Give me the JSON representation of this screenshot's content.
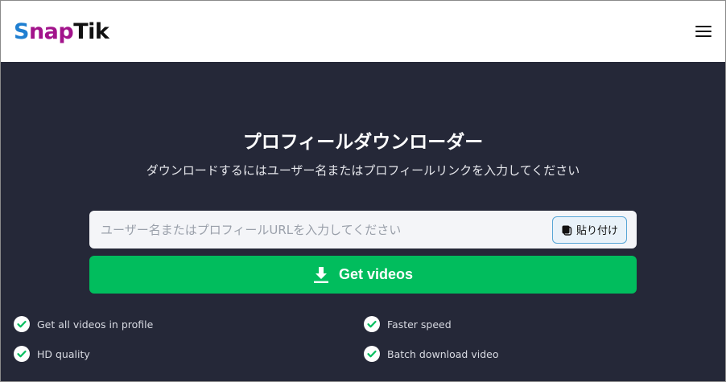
{
  "header": {
    "logo": {
      "part1": "Snap",
      "part2": "Tik"
    },
    "menu_icon": "hamburger-menu-icon"
  },
  "hero": {
    "title": "プロフィールダウンローダー",
    "subtitle": "ダウンロードするにはユーザー名またはプロフィールリンクを入力してください"
  },
  "search": {
    "placeholder": "ユーザー名またはプロフィールURLを入力してください",
    "value": "",
    "paste_label": "貼り付け",
    "paste_icon": "clipboard-icon"
  },
  "submit": {
    "label": "Get videos",
    "icon": "download-icon"
  },
  "features": [
    {
      "label": "Get all videos in profile"
    },
    {
      "label": "Faster speed"
    },
    {
      "label": "HD quality"
    },
    {
      "label": "Batch download video"
    }
  ],
  "colors": {
    "brand_blue": "#1f7fd1",
    "brand_magenta": "#a2138b",
    "background_dark": "#252838",
    "accent_green": "#01bd5d"
  }
}
